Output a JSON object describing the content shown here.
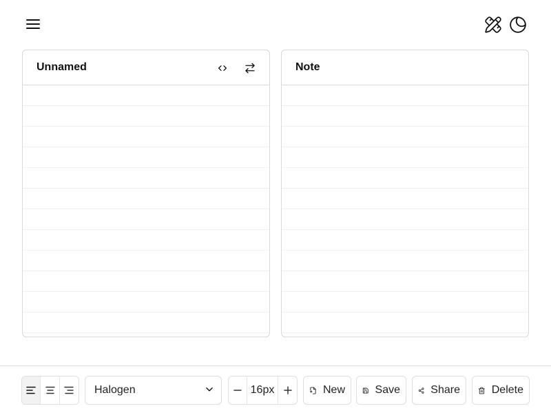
{
  "topbar": {
    "menu_icon": "hamburger-menu-icon",
    "design_icon": "pencil-ruler-icon",
    "theme_icon": "moon-circle-icon"
  },
  "panels": {
    "left": {
      "title": "Unnamed",
      "actions": [
        {
          "icon": "code-icon",
          "label": "Code view"
        },
        {
          "icon": "swap-icon",
          "label": "Swap"
        }
      ]
    },
    "right": {
      "title": "Note"
    }
  },
  "bottombar": {
    "align": {
      "options": [
        "left",
        "center",
        "right"
      ],
      "selected": "left"
    },
    "font": {
      "selected": "Halogen"
    },
    "font_size": {
      "value": "16px",
      "decrement_icon": "minus-icon",
      "increment_icon": "plus-icon"
    },
    "buttons": {
      "new": "New",
      "save": "Save",
      "share": "Share",
      "delete": "Delete"
    }
  },
  "colors": {
    "border": "#d9d9d9",
    "rule_line": "#f0f0f0",
    "active_segment": "#f2f2f2",
    "text": "#111111"
  }
}
